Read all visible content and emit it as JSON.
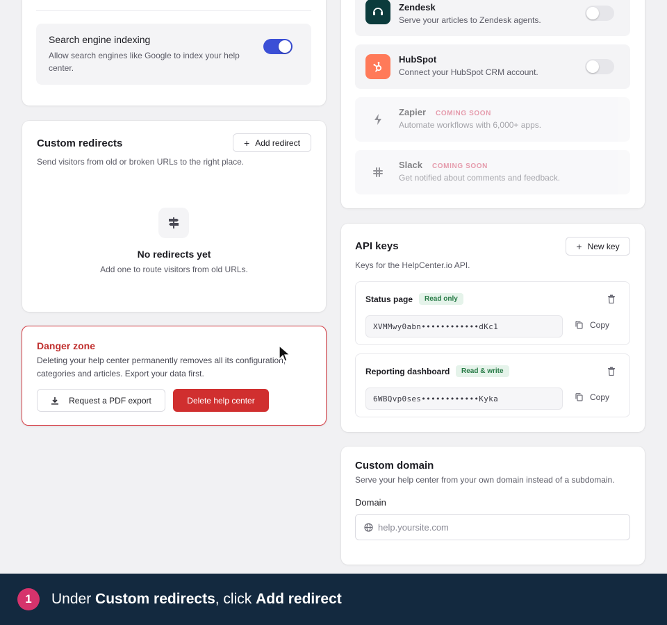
{
  "search_indexing": {
    "title": "Search engine indexing",
    "description": "Allow search engines like Google to index your help center.",
    "enabled": true
  },
  "custom_redirects": {
    "title": "Custom redirects",
    "subtitle": "Send visitors from old or broken URLs to the right place.",
    "add_button": "Add redirect",
    "empty_title": "No redirects yet",
    "empty_sub": "Add one to route visitors from old URLs."
  },
  "danger_zone": {
    "title": "Danger zone",
    "description_line1": "Deleting your help center permanently removes all its configuration,",
    "description_line2": "categories and articles. Export your data first.",
    "export_button": "Request a PDF export",
    "delete_button": "Delete help center"
  },
  "integrations": [
    {
      "name": "Zendesk",
      "description": "Serve your articles to Zendesk agents.",
      "enabled": false,
      "icon": "headset-icon",
      "color": "#0b3b3c"
    },
    {
      "name": "HubSpot",
      "description": "Connect your HubSpot CRM account.",
      "enabled": false,
      "icon": "hubspot-icon",
      "color": "#ff7a59"
    },
    {
      "name": "Zapier",
      "description": "Automate workflows with 6,000+ apps.",
      "badge": "COMING SOON",
      "icon": "bolt-icon"
    },
    {
      "name": "Slack",
      "description": "Get notified about comments and feedback.",
      "badge": "COMING SOON",
      "icon": "slack-icon"
    }
  ],
  "api_keys": {
    "title": "API keys",
    "subtitle": "Keys for the HelpCenter.io API.",
    "new_button": "New key",
    "copy_label": "Copy",
    "keys": [
      {
        "name": "Status page",
        "badge": "Read only",
        "value": "XVMMwy0abn••••••••••••dKc1"
      },
      {
        "name": "Reporting dashboard",
        "badge": "Read & write",
        "value": "6WBQvp0ses••••••••••••Kyka"
      }
    ]
  },
  "custom_domain": {
    "title": "Custom domain",
    "subtitle": "Serve your help center from your own domain instead of a subdomain.",
    "field_label": "Domain",
    "placeholder": "help.yoursite.com"
  },
  "tutorial": {
    "step": "1",
    "prefix": "Under ",
    "section": "Custom redirects",
    "middle": ", click ",
    "action": "Add redirect"
  },
  "colors": {
    "accent": "#3b4fd6",
    "danger": "#d02f2f",
    "banner": "#13293f",
    "step_badge": "#d6336c"
  }
}
